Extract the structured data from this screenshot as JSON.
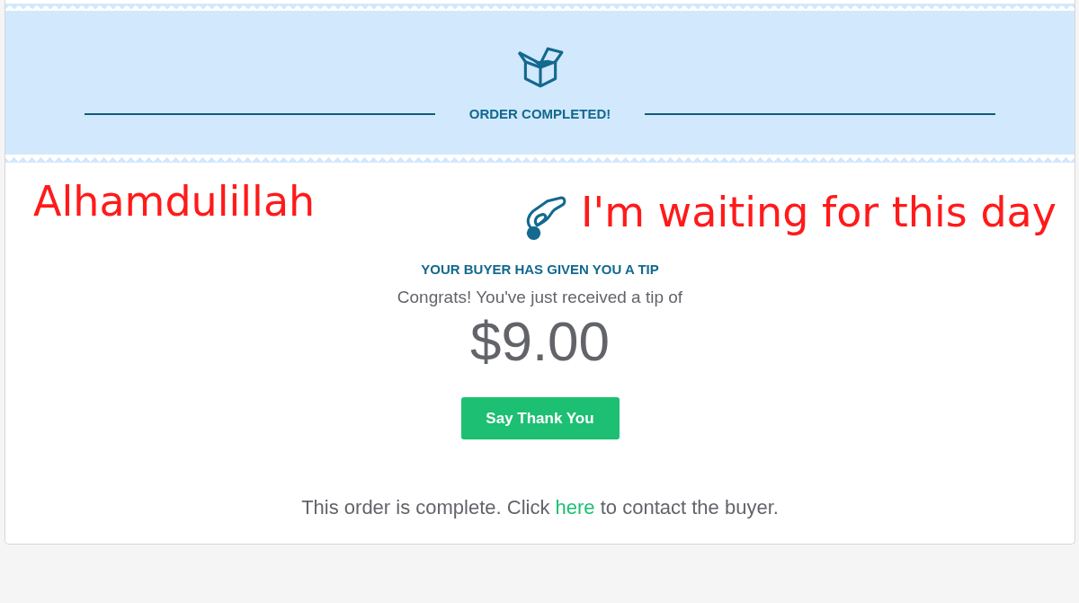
{
  "banner": {
    "title": "ORDER COMPLETED!"
  },
  "annotations": [
    "Alhamdulillah",
    "I'm waiting for this day"
  ],
  "tip": {
    "heading": "YOUR BUYER HAS GIVEN YOU A TIP",
    "message": "Congrats! You've just received a tip of",
    "amount": "$9.00",
    "button": "Say Thank You"
  },
  "footer": {
    "text_before": "This order is complete. Click ",
    "link": "here",
    "text_after": " to contact the buyer."
  }
}
